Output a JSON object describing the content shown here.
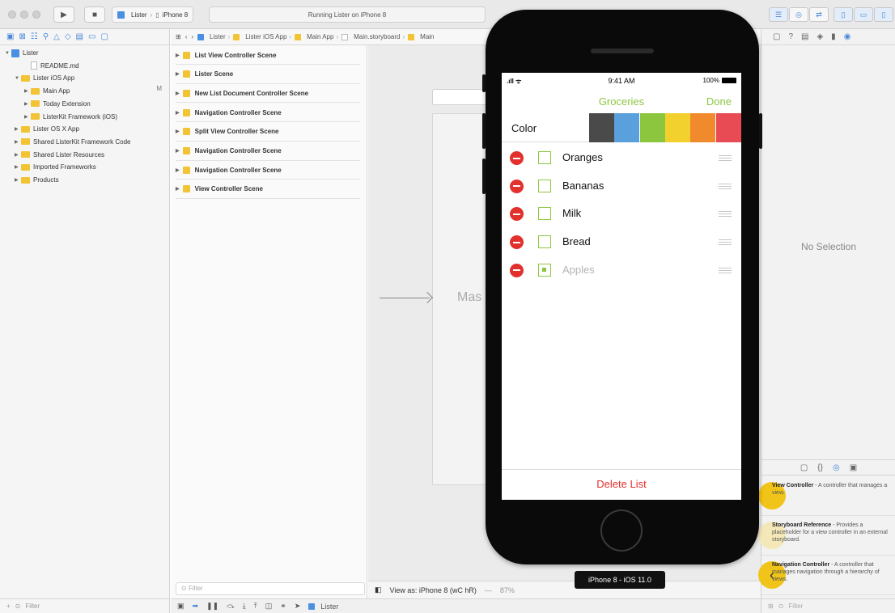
{
  "toolbar": {
    "scheme_project": "Lister",
    "scheme_device": "iPhone 8",
    "activity": "Running Lister on iPhone 8"
  },
  "navigator": {
    "items": [
      {
        "label": "Lister",
        "kind": "project",
        "indent": 0,
        "disclosure": "▼"
      },
      {
        "label": "README.md",
        "kind": "file",
        "indent": 2,
        "disclosure": ""
      },
      {
        "label": "Lister iOS App",
        "kind": "folder",
        "indent": 1,
        "disclosure": "▼"
      },
      {
        "label": "Main App",
        "kind": "folder",
        "indent": 2,
        "disclosure": "▶",
        "badge": "M"
      },
      {
        "label": "Today Extension",
        "kind": "folder",
        "indent": 2,
        "disclosure": "▶"
      },
      {
        "label": "ListerKit Framework (iOS)",
        "kind": "folder",
        "indent": 2,
        "disclosure": "▶"
      },
      {
        "label": "Lister OS X App",
        "kind": "folder",
        "indent": 1,
        "disclosure": "▶"
      },
      {
        "label": "Shared ListerKit Framework Code",
        "kind": "folder",
        "indent": 1,
        "disclosure": "▶"
      },
      {
        "label": "Shared Lister Resources",
        "kind": "folder",
        "indent": 1,
        "disclosure": "▶"
      },
      {
        "label": "Imported Frameworks",
        "kind": "folder",
        "indent": 1,
        "disclosure": "▶"
      },
      {
        "label": "Products",
        "kind": "folder",
        "indent": 1,
        "disclosure": "▶"
      }
    ],
    "filter_placeholder": "Filter"
  },
  "jumpbar": [
    "Lister",
    "Lister iOS App",
    "Main App",
    "Main.storyboard",
    "Main"
  ],
  "outline": {
    "scenes": [
      "List View Controller Scene",
      "Lister Scene",
      "New List Document Controller Scene",
      "Navigation Controller Scene",
      "Split View Controller Scene",
      "Navigation Controller Scene",
      "Navigation Controller Scene",
      "View Controller Scene"
    ],
    "filter_placeholder": "Filter"
  },
  "canvas": {
    "master_label": "Mas",
    "view_as": "View as: iPhone 8 (wC hR)",
    "zoom": "87%",
    "device_tip": "iPhone 8 - iOS 11.0"
  },
  "bottom_toolbar": {
    "target": "Lister"
  },
  "inspector": {
    "no_selection": "No Selection",
    "library": [
      {
        "title": "View Controller",
        "desc": " - A controller that manages a view.",
        "glyph": ""
      },
      {
        "title": "Storyboard Reference",
        "desc": " - Provides a placeholder for a view controller in an external storyboard.",
        "glyph": ""
      },
      {
        "title": "Navigation Controller",
        "desc": " - A controller that manages navigation through a hierarchy of views.",
        "glyph": "‹"
      }
    ],
    "filter_placeholder": "Filter"
  },
  "phone": {
    "status": {
      "time": "9:41 AM",
      "battery": "100%"
    },
    "nav_title": "Groceries",
    "done_label": "Done",
    "color_label": "Color",
    "swatches": [
      "#4a4a4a",
      "#5aa0dc",
      "#8cc63f",
      "#f2d12e",
      "#f08a2c",
      "#e94b55"
    ],
    "items": [
      {
        "label": "Oranges",
        "checked": false
      },
      {
        "label": "Bananas",
        "checked": false
      },
      {
        "label": "Milk",
        "checked": false
      },
      {
        "label": "Bread",
        "checked": false
      },
      {
        "label": "Apples",
        "checked": true
      }
    ],
    "delete_list": "Delete List"
  },
  "colors": {
    "accent": "#8cc63f",
    "destructive": "#e2302d",
    "folder": "#f2c433",
    "xcode_blue": "#4a86d8"
  }
}
